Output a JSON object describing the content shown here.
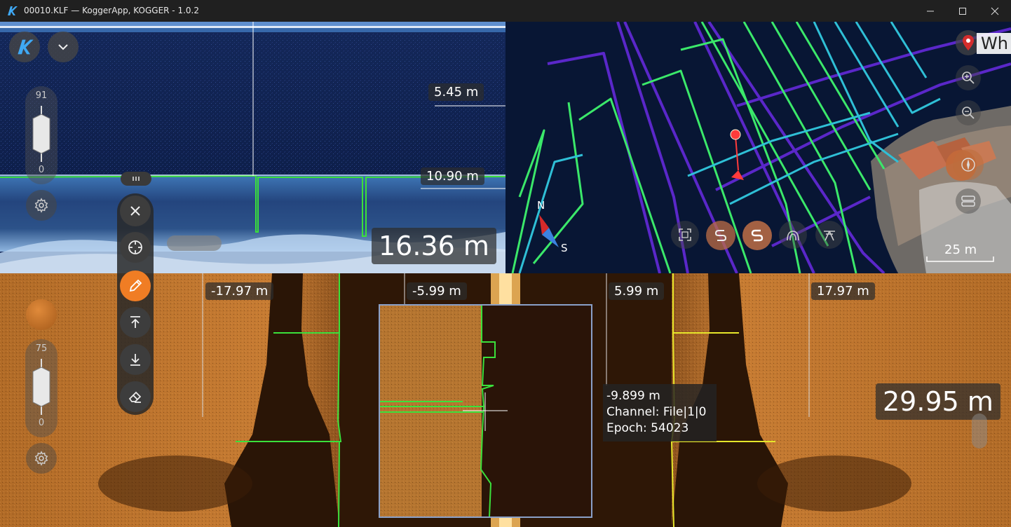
{
  "window": {
    "title": "00010.KLF — KoggerApp, KOGGER - 1.0.2",
    "icons": {
      "logo": "kogger-logo-icon",
      "minimize": "minimize-icon",
      "maximize": "maximize-icon",
      "close": "close-icon"
    }
  },
  "echogram": {
    "depth_labels": [
      "5.45 m",
      "10.90 m"
    ],
    "current_depth": "16.36 m",
    "brightness_slider": {
      "max": "91",
      "min": "0"
    },
    "icons": [
      "kogger-menu-icon",
      "chevron-down-icon",
      "gear-icon"
    ]
  },
  "map": {
    "search_partial": "Wh",
    "compass": {
      "north": "N",
      "south": "S"
    },
    "scale": "25 m",
    "icons": [
      "location-pin-icon",
      "zoom-in-icon",
      "zoom-out-icon",
      "compass-rose-icon",
      "layers-icon",
      "fit-view-icon",
      "track-icon",
      "track-sync-icon",
      "signal-icon",
      "antenna-icon"
    ]
  },
  "sidescan": {
    "range_labels": [
      "-17.97 m",
      "-5.99 m",
      "5.99 m",
      "17.97 m"
    ],
    "current_depth": "29.95 m",
    "brightness_slider": {
      "max": "75",
      "min": "0"
    },
    "tooltip": {
      "line1": "-9.899 m",
      "line2": "Channel: File|1|0",
      "line3": "Epoch: 54023"
    },
    "colors": {
      "sonar": "#b36a22",
      "bottom_trace_left": "#39e639",
      "bottom_trace_right": "#e6e62a"
    }
  },
  "toolbar": {
    "tools": [
      "close-icon",
      "target-icon",
      "pencil-icon",
      "upload-icon",
      "download-icon",
      "eraser-icon"
    ],
    "active_tool": "pencil-icon",
    "active_color": "#f07d24"
  }
}
